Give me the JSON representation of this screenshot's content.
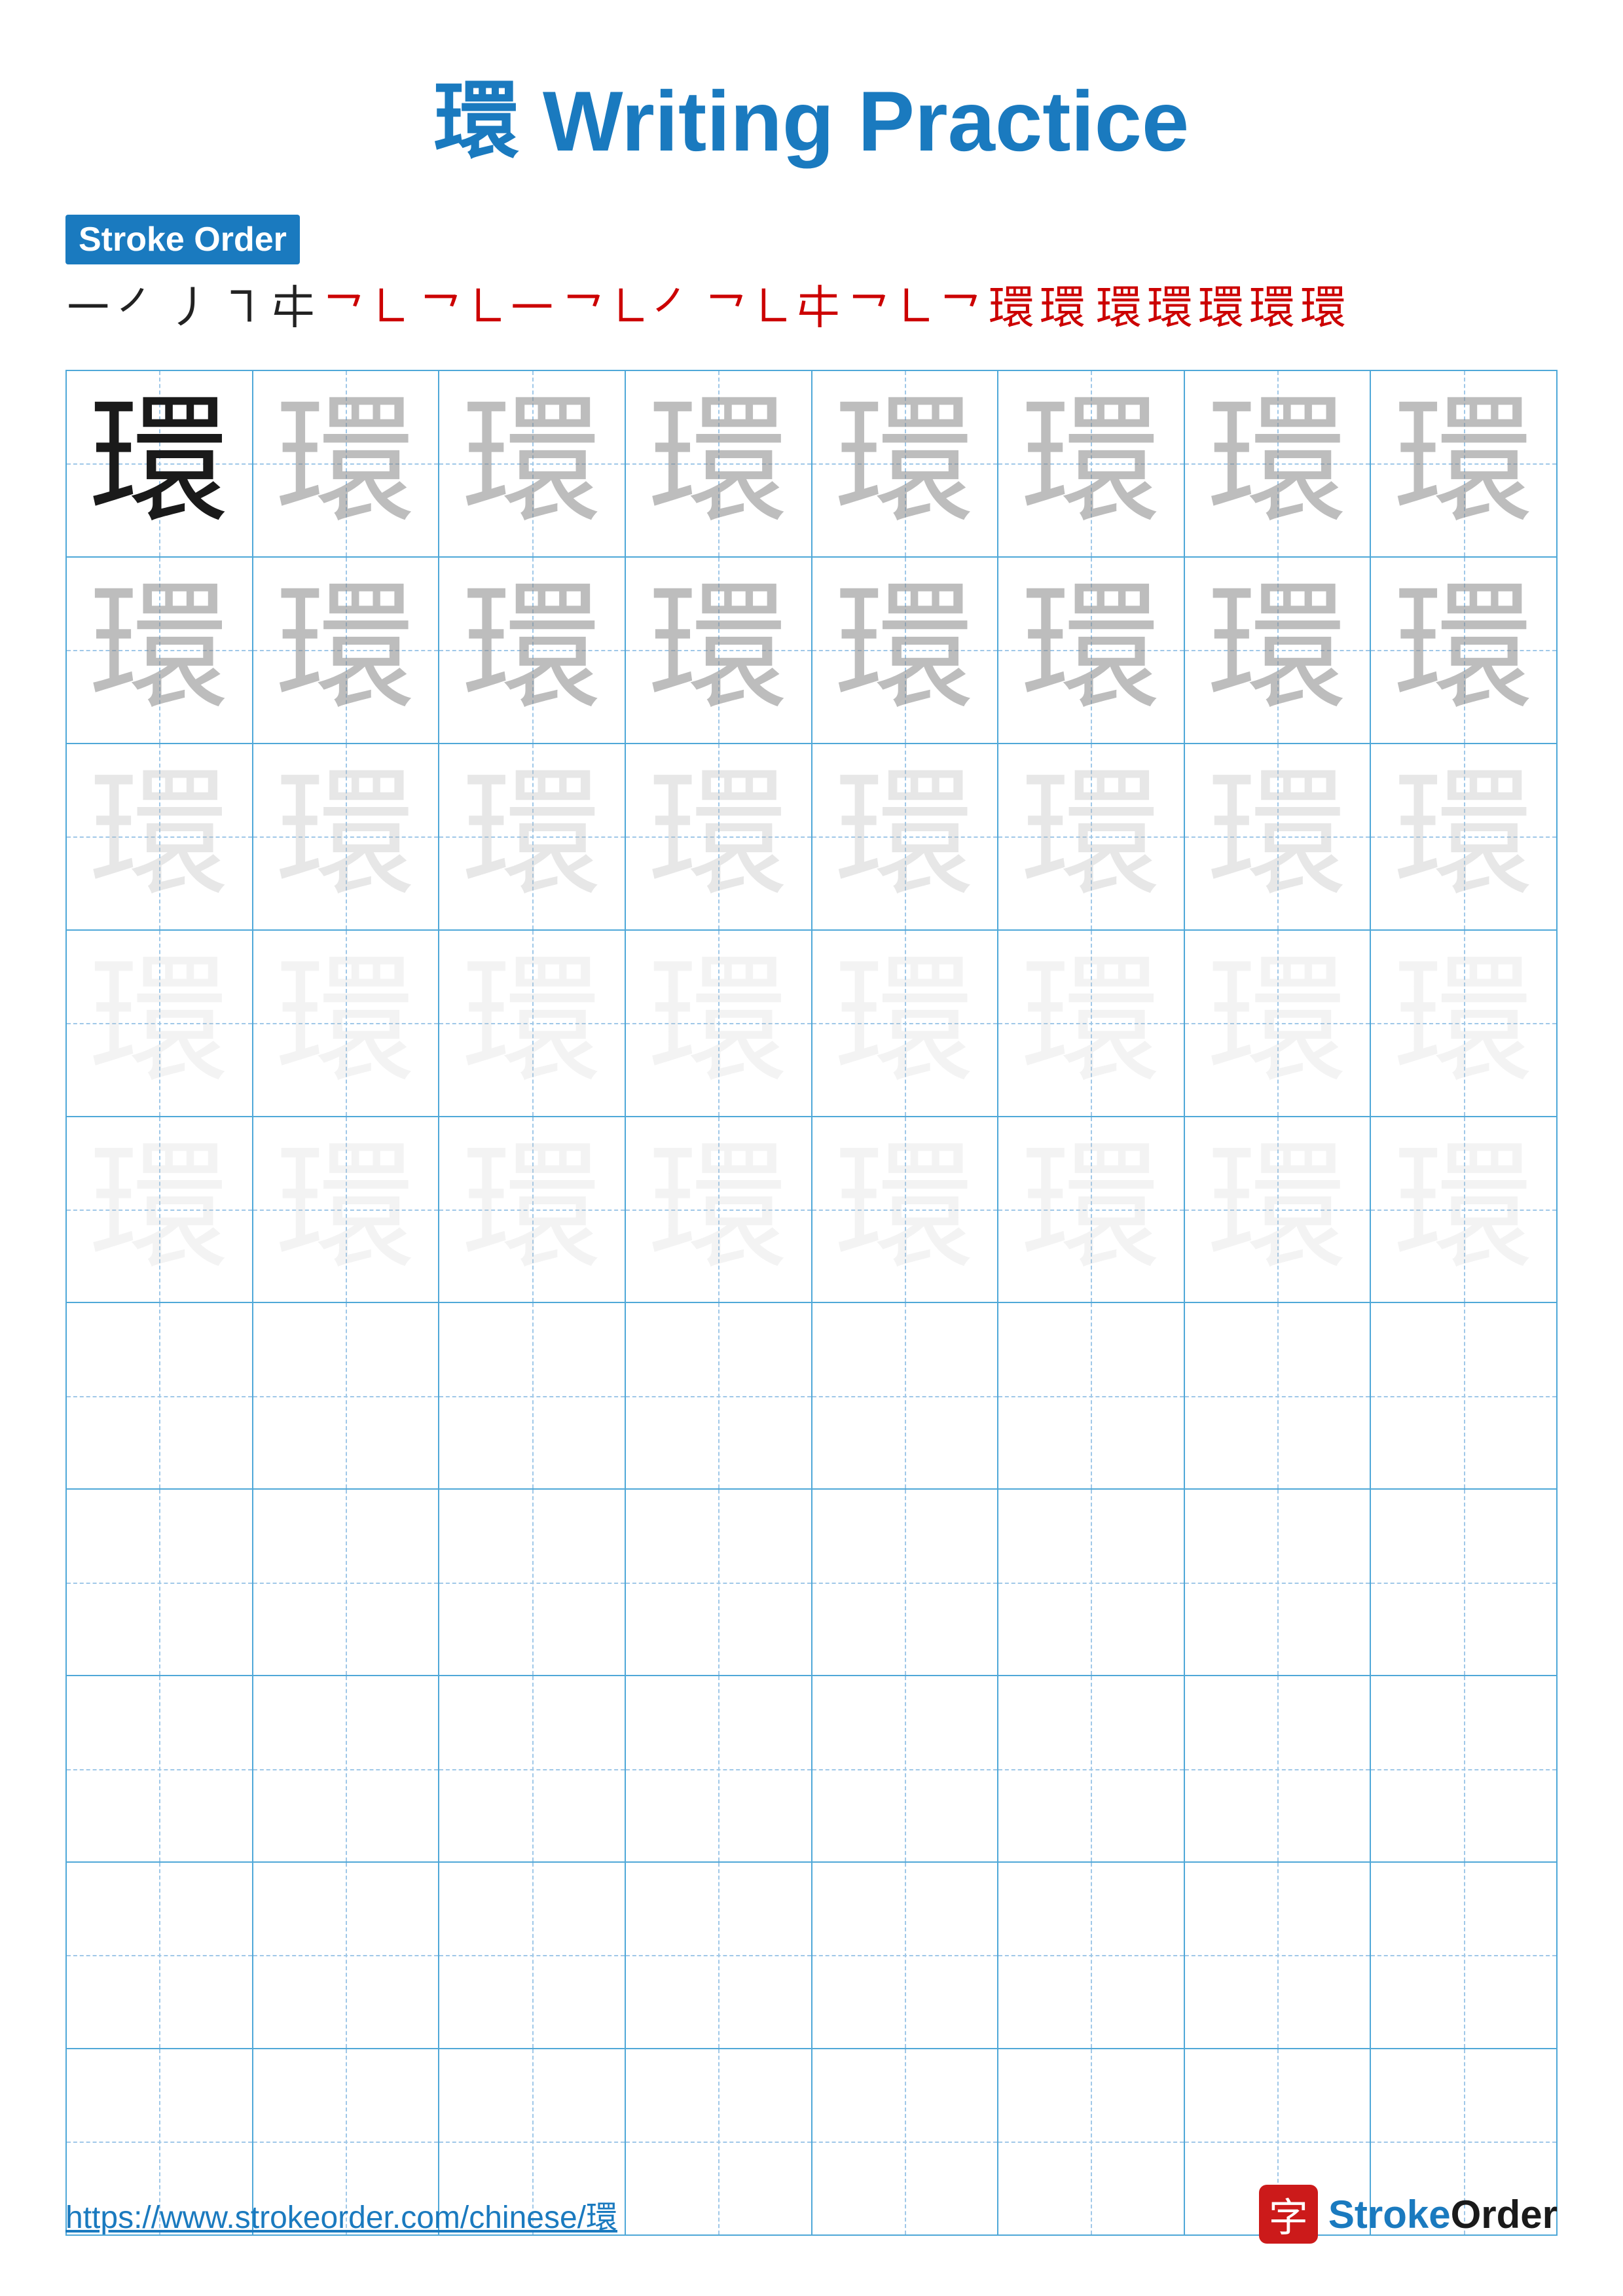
{
  "title": {
    "char": "環",
    "text": " Writing Practice"
  },
  "stroke_order": {
    "label": "Stroke Order",
    "sequence": [
      "㇐",
      "㇒",
      "㇓",
      "㇕",
      "㐄",
      "㇖㇗",
      "㇖㇗㇐",
      "㇖㇗㇐㇒",
      "㇖㇗㇐㇒㐄",
      "㇖㇗㇐㇒㐄㇖",
      "㇖㇗㇐㇒㐄㇖㇗",
      "環",
      "環",
      "環",
      "環",
      "環"
    ]
  },
  "grid": {
    "cols": 8,
    "rows_with_chars": 5,
    "empty_rows": 5,
    "char": "環",
    "opacity_rows": [
      "dark",
      "medium",
      "light",
      "vlight",
      "vlight"
    ]
  },
  "footer": {
    "url": "https://www.strokeorder.com/chinese/環",
    "brand_char": "字",
    "brand_name": "StrokeOrder"
  }
}
